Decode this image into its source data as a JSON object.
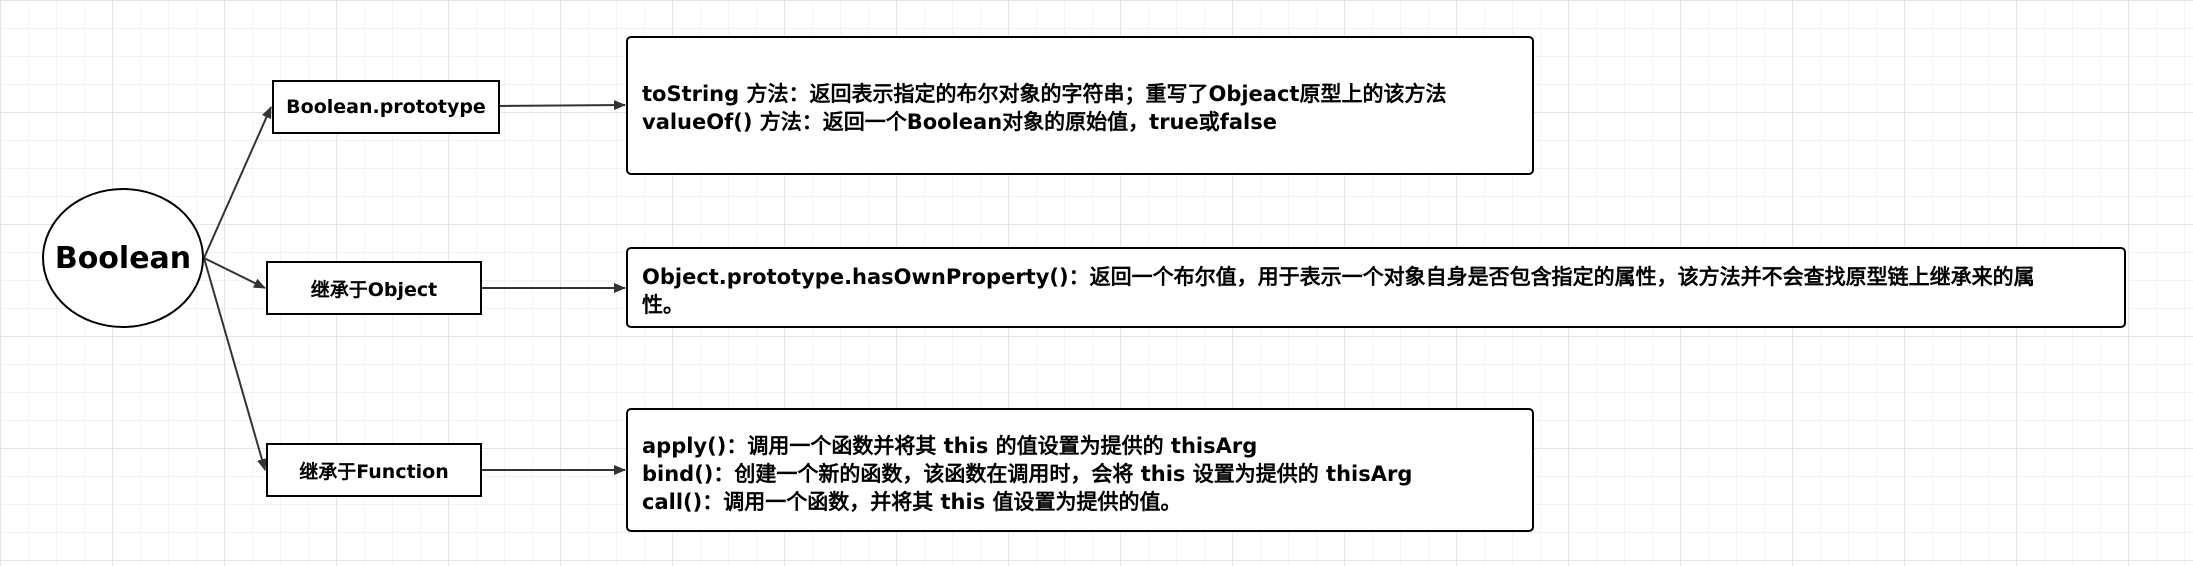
{
  "root": {
    "label": "Boolean"
  },
  "branches": [
    {
      "label": "Boolean.prototype",
      "lines": [
        "toString 方法：返回表示指定的布尔对象的字符串；重写了Objeact原型上的该方法",
        "valueOf() 方法：返回一个Boolean对象的原始值，true或false"
      ]
    },
    {
      "label": "继承于Object",
      "lines": [
        "Object.prototype.hasOwnProperty()：返回一个布尔值，用于表示一个对象自身是否包含指定的属性，该方法并不会查找原型链上继承来的属",
        "性。"
      ]
    },
    {
      "label": "继承于Function",
      "lines": [
        "apply()：调用一个函数并将其 this 的值设置为提供的 thisArg",
        "bind()：创建一个新的函数，该函数在调用时，会将 this 设置为提供的 thisArg",
        "call()：调用一个函数，并将其 this 值设置为提供的值。"
      ]
    }
  ]
}
